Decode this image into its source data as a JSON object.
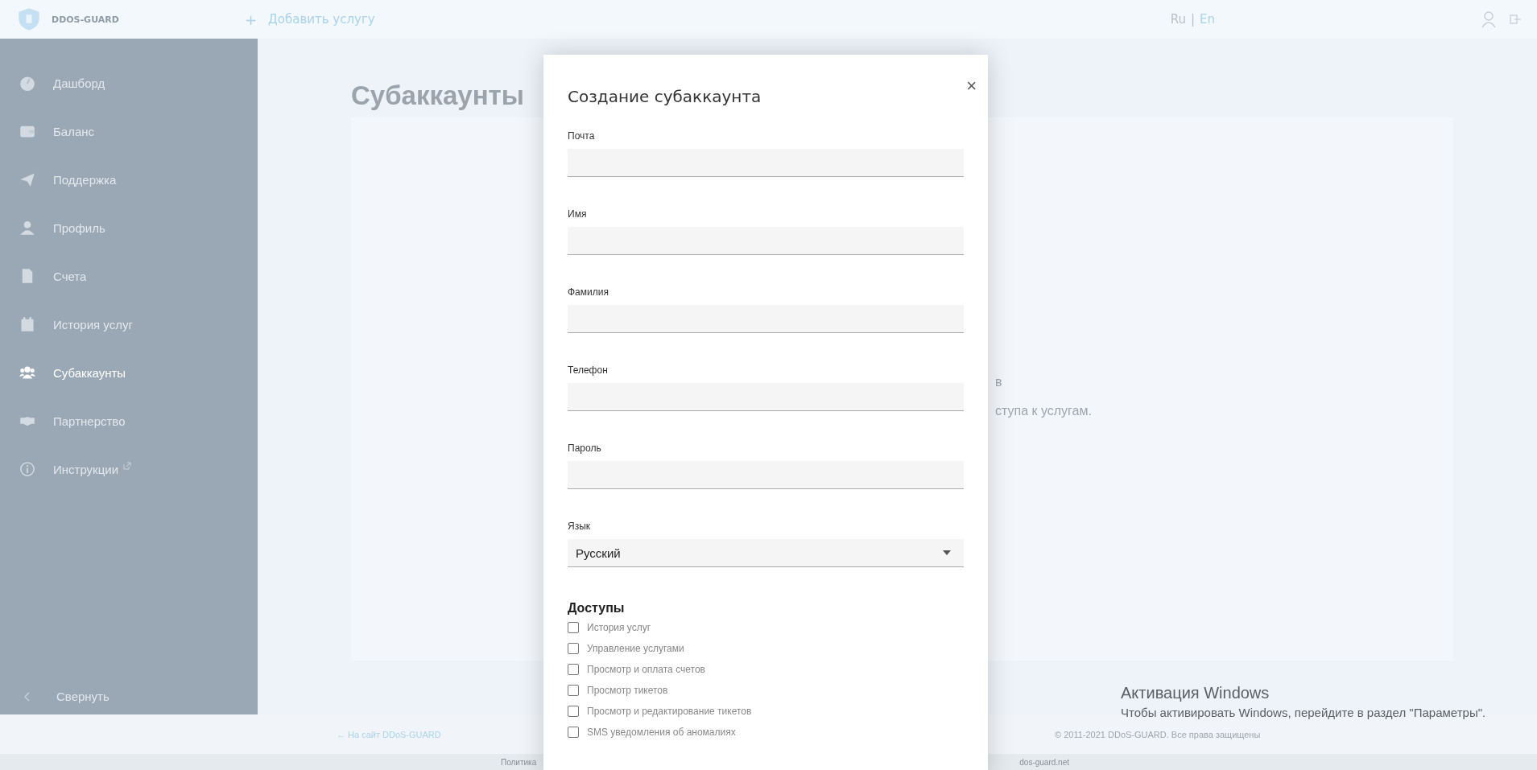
{
  "header": {
    "logo_text": "DDOS-GUARD",
    "add_service": "Добавить услугу",
    "add_icon": "+",
    "languages": [
      {
        "label": "Ru",
        "selected": false
      },
      {
        "label": "En",
        "selected": true
      }
    ],
    "separator": "|"
  },
  "sidebar": {
    "items": [
      {
        "label": "Дашборд",
        "selected": false,
        "external": false
      },
      {
        "label": "Баланс",
        "selected": false,
        "external": false
      },
      {
        "label": "Поддержка",
        "selected": false,
        "external": false
      },
      {
        "label": "Профиль",
        "selected": false,
        "external": false
      },
      {
        "label": "Счета",
        "selected": false,
        "external": false
      },
      {
        "label": "История услуг",
        "selected": false,
        "external": false
      },
      {
        "label": "Субаккаунты",
        "selected": true,
        "external": false
      },
      {
        "label": "Партнерство",
        "selected": false,
        "external": false
      },
      {
        "label": "Инструкции",
        "selected": false,
        "external": true
      }
    ],
    "collapse": "Свернуть"
  },
  "page": {
    "title": "Субаккаунты",
    "card_text_1": "в",
    "card_text_2": "ступа к услугам."
  },
  "footer": {
    "back_link": "← На сайт DDoS-GUARD",
    "copyright": "© 2011-2021 DDoS-GUARD. Все права защищены"
  },
  "bottom_bar": {
    "left": "Политика",
    "right": "dos-guard.net"
  },
  "modal": {
    "title": "Создание субаккаунта",
    "close": "×",
    "fields": [
      {
        "label": "Почта",
        "kind": "text"
      },
      {
        "label": "Имя",
        "kind": "text"
      },
      {
        "label": "Фамилия",
        "kind": "text"
      },
      {
        "label": "Телефон",
        "kind": "text"
      },
      {
        "label": "Пароль",
        "kind": "password"
      },
      {
        "label": "Язык",
        "kind": "select",
        "value": "Русский"
      }
    ],
    "access_title": "Доступы",
    "permissions": [
      {
        "label": "История услуг",
        "checked": false
      },
      {
        "label": "Управление услугами",
        "checked": false
      },
      {
        "label": "Просмотр и оплата счетов",
        "checked": false
      },
      {
        "label": "Просмотр тикетов",
        "checked": false
      },
      {
        "label": "Просмотр и редактирование тикетов",
        "checked": false
      },
      {
        "label": "SMS уведомления об аномалиях",
        "checked": false
      }
    ]
  },
  "os_notice": {
    "title": "Активация Windows",
    "text": "Чтобы активировать Windows, перейдите в раздел \"Параметры\"."
  }
}
